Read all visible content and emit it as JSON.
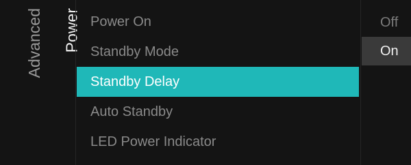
{
  "breadcrumb": {
    "parent_label": "Advanced",
    "current_label": "Power"
  },
  "menu": {
    "items": [
      {
        "label": "Power On",
        "selected": false
      },
      {
        "label": "Standby Mode",
        "selected": false
      },
      {
        "label": "Standby Delay",
        "selected": true
      },
      {
        "label": "Auto Standby",
        "selected": false
      },
      {
        "label": "LED Power Indicator",
        "selected": false
      }
    ]
  },
  "options": {
    "items": [
      {
        "label": "Off",
        "active": false
      },
      {
        "label": "On",
        "active": true
      }
    ]
  },
  "colors": {
    "background": "#141414",
    "highlight": "#1fb8b8",
    "option_active_bg": "#3a3a3a",
    "inactive_text": "#8a8a8a",
    "active_text": "#ffffff"
  }
}
